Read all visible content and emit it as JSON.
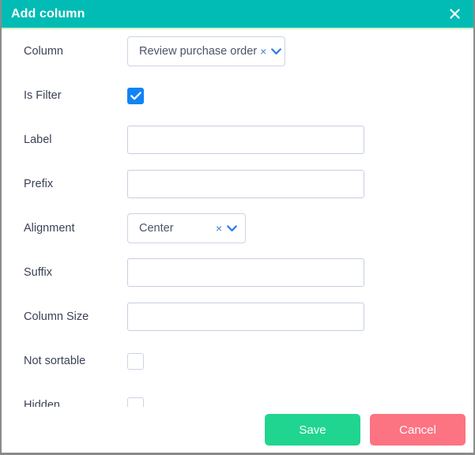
{
  "header": {
    "title": "Add column",
    "close_icon": "close-icon",
    "background_color": "#00bcb4",
    "accent_underline_color": "#c8f0c4"
  },
  "form": {
    "rows": [
      {
        "label": "Column",
        "type": "select",
        "value": "Review purchase order",
        "clear_glyph": "×",
        "caret_icon": "chevron-down-icon",
        "name": "column"
      },
      {
        "label": "Is Filter",
        "type": "checkbox",
        "checked": true,
        "name": "is-filter"
      },
      {
        "label": "Label",
        "type": "text",
        "value": "",
        "placeholder": "",
        "name": "label"
      },
      {
        "label": "Prefix",
        "type": "text",
        "value": "",
        "placeholder": "",
        "name": "prefix"
      },
      {
        "label": "Alignment",
        "type": "select",
        "value": "Center",
        "clear_glyph": "×",
        "caret_icon": "chevron-down-icon",
        "name": "alignment"
      },
      {
        "label": "Suffix",
        "type": "text",
        "value": "",
        "placeholder": "",
        "name": "suffix"
      },
      {
        "label": "Column Size",
        "type": "text",
        "value": "",
        "placeholder": "",
        "name": "column-size"
      },
      {
        "label": "Not sortable",
        "type": "checkbox",
        "checked": false,
        "name": "not-sortable"
      },
      {
        "label": "Hidden",
        "type": "checkbox",
        "checked": false,
        "name": "hidden"
      }
    ]
  },
  "footer": {
    "save_label": "Save",
    "cancel_label": "Cancel",
    "save_color": "#20d58f",
    "cancel_color": "#fc7382"
  }
}
